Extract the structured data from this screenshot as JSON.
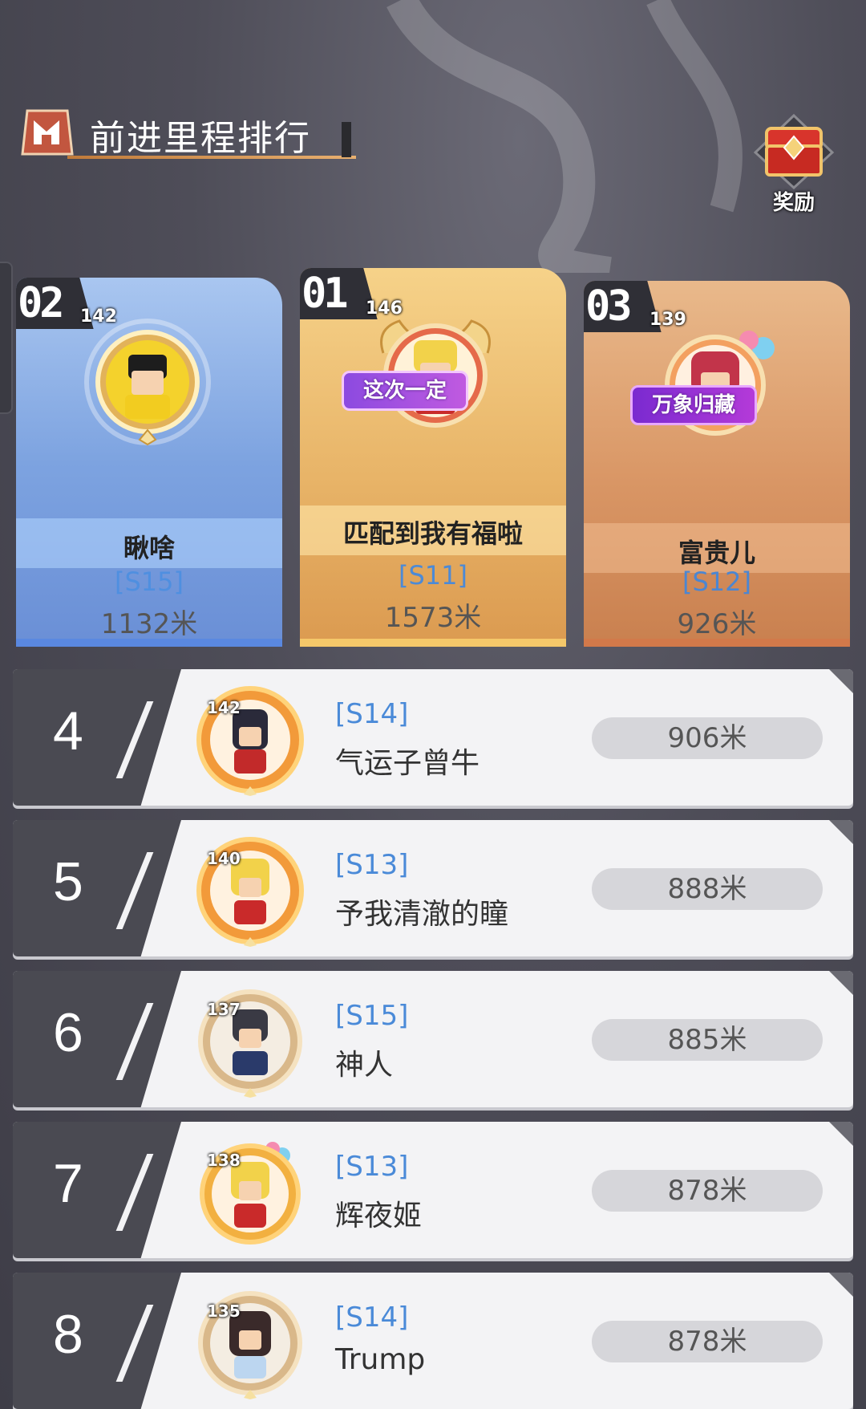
{
  "header": {
    "title": "前进里程排行"
  },
  "reward": {
    "label": "奖励"
  },
  "podium": [
    {
      "rank_label": "02",
      "level": "142",
      "name": "瞅啥",
      "server": "[S15]",
      "distance": "1132米"
    },
    {
      "rank_label": "01",
      "level": "146",
      "name": "匹配到我有福啦",
      "server": "[S11]",
      "distance": "1573米",
      "tag": "这次一定"
    },
    {
      "rank_label": "03",
      "level": "139",
      "name": "富贵儿",
      "server": "[S12]",
      "distance": "926米",
      "tag": "万象归藏"
    }
  ],
  "ranking": [
    {
      "rank": "4",
      "level": "142",
      "server": "[S14]",
      "name": "气运子曾牛",
      "distance": "906米"
    },
    {
      "rank": "5",
      "level": "140",
      "server": "[S13]",
      "name": "予我清澈的瞳",
      "distance": "888米"
    },
    {
      "rank": "6",
      "level": "137",
      "server": "[S15]",
      "name": "神人",
      "distance": "885米"
    },
    {
      "rank": "7",
      "level": "138",
      "server": "[S13]",
      "name": "辉夜姬",
      "distance": "878米"
    },
    {
      "rank": "8",
      "level": "135",
      "server": "[S14]",
      "name": "Trump",
      "distance": "878米"
    }
  ],
  "colors": {
    "server_blue": "#4a8ad8",
    "rank_box": "#4a4a52",
    "gold": "#e8b468",
    "silver_blue": "#7da3e0",
    "bronze": "#d99665"
  }
}
